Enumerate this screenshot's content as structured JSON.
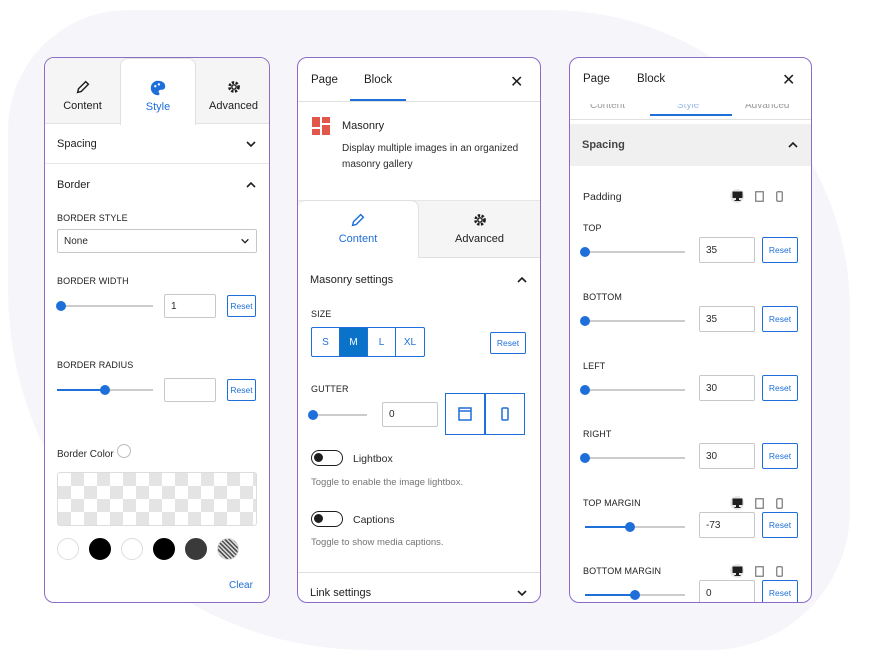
{
  "panel1": {
    "tabs": [
      {
        "label": "Content",
        "icon": "pencil-icon"
      },
      {
        "label": "Style",
        "icon": "palette-icon",
        "active": true
      },
      {
        "label": "Advanced",
        "icon": "gear-icon"
      }
    ],
    "spacing_label": "Spacing",
    "border_label": "Border",
    "border_style_label": "BORDER STYLE",
    "border_style_value": "None",
    "border_width_label": "BORDER WIDTH",
    "border_width_value": "1",
    "border_width_fraction": 0.02,
    "border_radius_label": "BORDER RADIUS",
    "border_radius_value": "",
    "border_radius_fraction": 0.5,
    "reset_label": "Reset",
    "border_color_label": "Border Color",
    "swatches": [
      "#ffffff",
      "#000000",
      "#ffffff",
      "#000000",
      "#3a3a3a",
      "pattern"
    ],
    "clear_label": "Clear"
  },
  "panel2": {
    "tab_page": "Page",
    "tab_block": "Block",
    "block_name": "Masonry",
    "block_desc": "Display multiple images in an organized masonry gallery",
    "tabs": [
      {
        "label": "Content",
        "icon": "pencil-icon",
        "active": true
      },
      {
        "label": "Advanced",
        "icon": "gear-icon"
      }
    ],
    "masonry_settings_label": "Masonry settings",
    "size_label": "SIZE",
    "sizes": [
      "S",
      "M",
      "L",
      "XL"
    ],
    "size_selected": "M",
    "reset_label": "Reset",
    "gutter_label": "GUTTER",
    "gutter_value": "0",
    "lightbox_label": "Lightbox",
    "lightbox_help": "Toggle to enable the image lightbox.",
    "captions_label": "Captions",
    "captions_help": "Toggle to show media captions.",
    "link_settings_label": "Link settings"
  },
  "panel3": {
    "tab_page": "Page",
    "tab_block": "Block",
    "spacing_label": "Spacing",
    "padding_label": "Padding",
    "reset_label": "Reset",
    "fields": [
      {
        "label": "TOP",
        "value": "35",
        "fraction": 0.0
      },
      {
        "label": "BOTTOM",
        "value": "35",
        "fraction": 0.0
      },
      {
        "label": "LEFT",
        "value": "30",
        "fraction": 0.0
      },
      {
        "label": "RIGHT",
        "value": "30",
        "fraction": 0.0
      },
      {
        "label": "TOP MARGIN",
        "value": "-73",
        "fraction": 0.45
      },
      {
        "label": "BOTTOM MARGIN",
        "value": "0",
        "fraction": 0.5
      }
    ]
  },
  "colors": {
    "accent": "#1e6fd9",
    "panel_border": "#8b6cc9",
    "masonry_icon": "#e2574c"
  }
}
